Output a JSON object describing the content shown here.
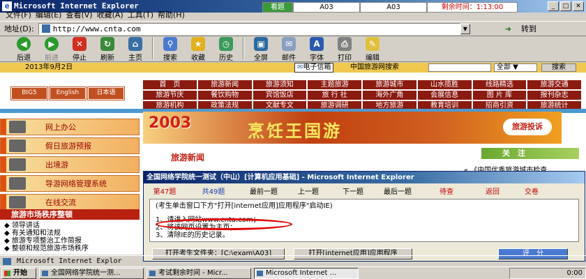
{
  "window": {
    "title": "Microsoft Internet Explorer"
  },
  "exam_top": {
    "status": "看题",
    "id1": "A03",
    "id2": "A03",
    "remaining_label": "剩余时间：",
    "remaining": "1:13:00"
  },
  "menu": [
    "文件(F)",
    "编辑(E)",
    "查看(V)",
    "收藏(A)",
    "工具(T)",
    "帮助(H)"
  ],
  "address": {
    "label": "地址(D):",
    "url": "http://www.cnta.com",
    "go": "转到"
  },
  "toolbar": {
    "back": "后退",
    "forward": "前进",
    "stop": "停止",
    "refresh": "刷新",
    "home": "主页",
    "search": "搜索",
    "favorites": "收藏",
    "history": "历史",
    "fullscreen": "全屏",
    "mail": "邮件",
    "font": "字体",
    "print": "打印",
    "edit": "编辑"
  },
  "web": {
    "date": "2013年9月2日",
    "email": "电子信箱",
    "site_search": "中国旅游网搜索",
    "scope": "全部",
    "search_btn": "搜索",
    "langs": [
      "BIG5",
      "English",
      "日本语"
    ],
    "nav_rows": [
      [
        "首　页",
        "旅游新闻",
        "旅游须知",
        "主题旅游",
        "旅游城市",
        "山水揽胜",
        "线路精选",
        "旅游交通"
      ],
      [
        "旅游节庆",
        "餐饮购物",
        "宾馆饭店",
        "旅 行 社",
        "海外广角",
        "会展信息",
        "图 片 库",
        "报刊杂志"
      ],
      [
        "旅游机构",
        "政策法规",
        "文献专文",
        "旅游调研",
        "地方旅游",
        "教育培训",
        "招商引资",
        "旅游统计"
      ]
    ],
    "side_items": [
      "网上办公",
      "假日旅游预报",
      "出境游",
      "导游网络管理系统",
      "在线交流"
    ],
    "market_banner": "旅游市场秩序整顿",
    "news": [
      "领导讲话",
      "有关通知和法规",
      "旅游专项整治工作简报",
      "整顿和规范旅游市场秩序"
    ],
    "banner_year": "2003",
    "banner_text": "烹饪王国游",
    "complaint": "旅游投诉",
    "news_header": "旅游新闻",
    "focus": "关　注",
    "focus_item": "《中国优秀旅游城市检查"
  },
  "dialog": {
    "title": "全国网络学院统一测试（中山）[计算机应用基础] - Microsoft Internet Explorer",
    "question_prefix": "第",
    "question_current": "47",
    "question_suffix": "题",
    "total_prefix": "共",
    "total": "49",
    "total_suffix": "题",
    "first": "最前一题",
    "prev": "上一题",
    "next": "下一题",
    "last": "最后一题",
    "pending": "待查",
    "back": "返回",
    "submit": "交卷",
    "instruction": "(考生单击窗口下方\"打开[internet应用]应用程序\"启动IE)",
    "step1": "1、请进入网站www.cnta.com；",
    "step2": "2、将该网页设置为主页；",
    "step3": "3、清除IE的历史记录。",
    "open_folder": "打开考生文件夹：[C:\\exam\\A03]",
    "open_app": "打开[internet应用]应用程序",
    "score": "评　分"
  },
  "statusbar": {
    "text": "Microsoft Internet Explor"
  },
  "taskbar": {
    "start": "开始",
    "items": [
      "全国网络学院统一测...",
      "考试剩余时间 - Micr...",
      "Microsoft Internet ..."
    ],
    "time": "0:00"
  }
}
